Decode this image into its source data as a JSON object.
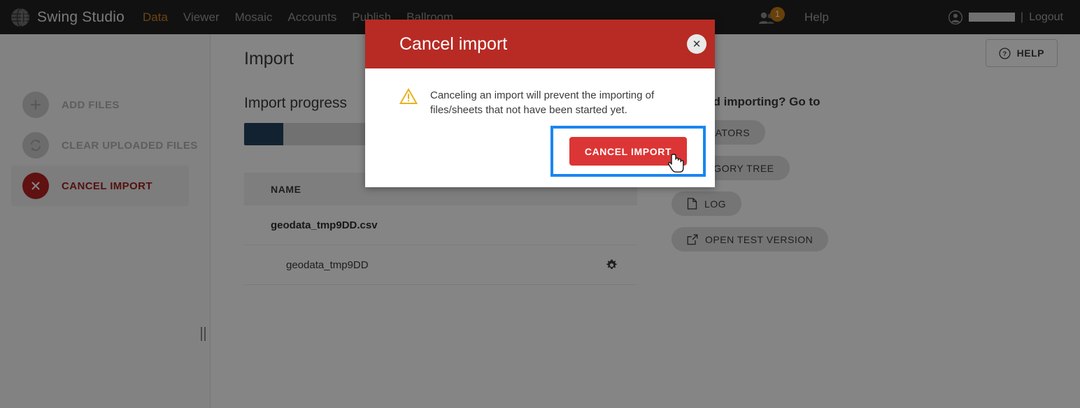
{
  "header": {
    "brand": "Swing Studio",
    "logo_icon": "globe-logo-icon",
    "nav": [
      {
        "label": "Data",
        "active": true
      },
      {
        "label": "Viewer",
        "active": false
      },
      {
        "label": "Mosaic",
        "active": false
      },
      {
        "label": "Accounts",
        "active": false
      },
      {
        "label": "Publish",
        "active": false
      },
      {
        "label": "Ballroom",
        "active": false
      }
    ],
    "users_icon": "users-icon",
    "users_badge": "1",
    "help": "Help",
    "account_icon": "user-circle-icon",
    "account_name": "",
    "separator": "|",
    "logout": "Logout"
  },
  "sidebar": {
    "items": [
      {
        "label": "ADD FILES",
        "icon": "plus-icon",
        "state": "disabled"
      },
      {
        "label": "CLEAR UPLOADED FILES",
        "icon": "refresh-icon",
        "state": "disabled"
      },
      {
        "label": "CANCEL IMPORT",
        "icon": "close-x-icon",
        "state": "active"
      }
    ],
    "resize_handle": "sidebar-resize-handle"
  },
  "main": {
    "page_title": "Import",
    "help_button": "HELP",
    "help_icon": "question-circle-icon",
    "section_title": "Import progress",
    "progress_percent": 10,
    "table": {
      "columns": [
        "NAME"
      ],
      "rows": [
        {
          "name": "geodata_tmp9DD.csv",
          "type": "file"
        },
        {
          "name": "geodata_tmp9DD",
          "type": "sheet",
          "action_icon": "gear-icon"
        }
      ]
    },
    "shortcuts": {
      "heading": "Finished importing? Go to",
      "buttons": [
        {
          "label": "INDICATORS",
          "icon": ""
        },
        {
          "label": "CATEGORY TREE",
          "icon": ""
        },
        {
          "label": "LOG",
          "icon": "document-icon"
        },
        {
          "label": "OPEN TEST VERSION",
          "icon": "external-link-icon"
        }
      ]
    }
  },
  "modal": {
    "title": "Cancel import",
    "close_icon": "close-icon",
    "warning_icon": "warning-triangle-icon",
    "message": "Canceling an import will prevent the importing of files/sheets that not have been started yet.",
    "confirm_button": "CANCEL IMPORT"
  },
  "colors": {
    "header_bg": "#222222",
    "nav_active": "#d08324",
    "modal_header": "#b72b24",
    "confirm_button": "#dc3535",
    "focus_ring": "#1a86f0",
    "progress_fill": "#23415e",
    "sidebar_active": "#b92222",
    "warning": "#e8b21c"
  }
}
